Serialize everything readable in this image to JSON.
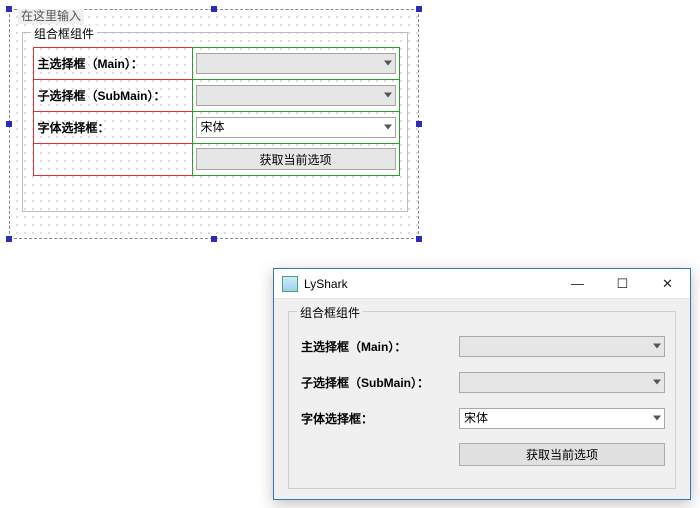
{
  "designer": {
    "placeholder": "在这里输入",
    "groupbox_title": "组合框组件",
    "rows": {
      "main_label": "主选择框（Main）：",
      "sub_label": "子选择框（SubMain）：",
      "font_label": "字体选择框：",
      "font_value": "宋体",
      "button_label": "获取当前选项"
    }
  },
  "runtime": {
    "window_title": "LyShark",
    "groupbox_title": "组合框组件",
    "rows": {
      "main_label": "主选择框（Main）：",
      "sub_label": "子选择框（SubMain）：",
      "font_label": "字体选择框：",
      "font_value": "宋体",
      "button_label": "获取当前选项"
    },
    "window_controls": {
      "minimize": "—",
      "maximize": "☐",
      "close": "✕"
    }
  }
}
